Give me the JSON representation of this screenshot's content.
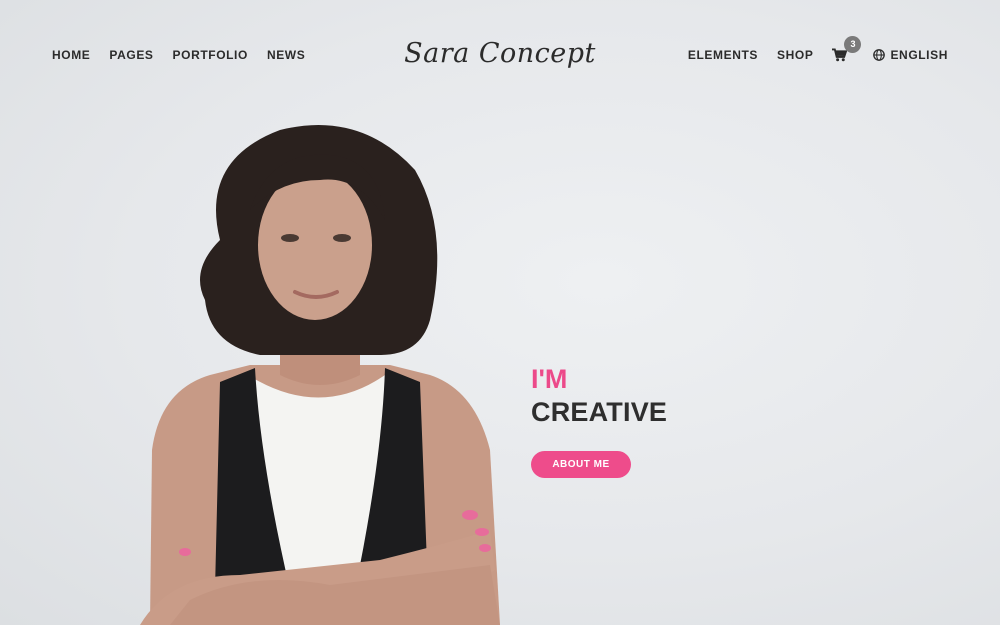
{
  "header": {
    "logo": "Sara Concept",
    "nav_left": [
      "HOME",
      "PAGES",
      "PORTFOLIO",
      "NEWS"
    ],
    "nav_right": [
      "ELEMENTS",
      "SHOP"
    ],
    "cart_count": "3",
    "language": "ENGLISH"
  },
  "hero": {
    "line1": "I'M",
    "line2": "CREATIVE",
    "button": "ABOUT ME"
  },
  "colors": {
    "accent": "#ee4c8b",
    "text_dark": "#2b2b2b",
    "background": "#e8eaec"
  },
  "icons": [
    "cart-icon",
    "globe-icon"
  ]
}
